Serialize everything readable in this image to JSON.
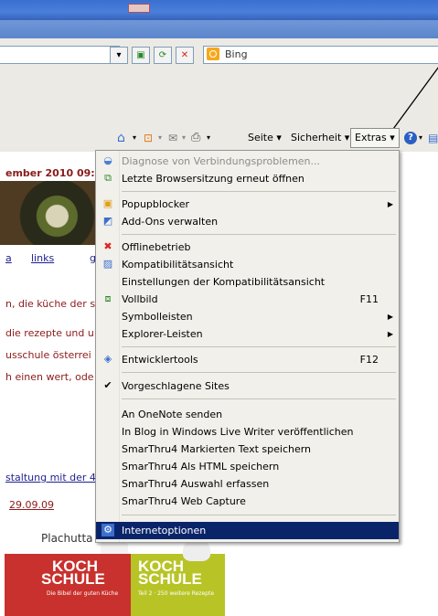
{
  "toolbar": {
    "search_engine": "Bing",
    "page_label": "Seite",
    "security_label": "Sicherheit",
    "extras_label": "Extras",
    "dropdown_arrow": "▾",
    "help_icon": "?"
  },
  "menu": {
    "items": [
      {
        "label": "Diagnose von Verbindungsproblemen...",
        "icon": "network-diagnose-icon",
        "disabled": true
      },
      {
        "label": "Letzte Browsersitzung erneut öffnen",
        "icon": "reopen-session-icon"
      },
      {
        "label": "Popupblocker",
        "icon": "popup-blocker-icon",
        "submenu": true
      },
      {
        "label": "Add-Ons verwalten",
        "icon": "addons-icon"
      },
      {
        "label": "Offlinebetrieb",
        "icon": "offline-icon"
      },
      {
        "label": "Kompatibilitätsansicht",
        "icon": "compatibility-icon"
      },
      {
        "label": "Einstellungen der Kompatibilitätsansicht"
      },
      {
        "label": "Vollbild",
        "icon": "fullscreen-icon",
        "shortcut": "F11"
      },
      {
        "label": "Symbolleisten",
        "submenu": true
      },
      {
        "label": "Explorer-Leisten",
        "submenu": true
      },
      {
        "label": "Entwicklertools",
        "icon": "developer-tools-icon",
        "shortcut": "F12"
      },
      {
        "label": "Vorgeschlagene Sites",
        "checked": true
      },
      {
        "label": "An OneNote senden"
      },
      {
        "label": "In Blog in Windows Live Writer veröffentlichen"
      },
      {
        "label": "SmarThru4 Markierten Text speichern"
      },
      {
        "label": "SmarThru4 Als HTML speichern"
      },
      {
        "label": "SmarThru4 Auswahl erfassen"
      },
      {
        "label": "SmarThru4 Web Capture"
      },
      {
        "label": "Internetoptionen",
        "icon": "internet-options-icon",
        "highlighted": true
      }
    ],
    "checkmark": "✔",
    "submenu_arrow": "▶"
  },
  "page": {
    "post_date": "ember 2010 09:5",
    "links": [
      "a",
      "links",
      "g"
    ],
    "lines": [
      "n, die küche der s",
      "die rezepte und u",
      "usschule österrei",
      "h einen wert, ode"
    ],
    "bottom_link": "staltung mit der 4",
    "bottom_date": "29.09.09",
    "book_brand": "Plachutta",
    "book_left_title_1": "KOCH",
    "book_left_title_2": "SCHULE",
    "book_left_sub": "Die Bibel der guten Küche",
    "book_right_title_1": "KOCH",
    "book_right_title_2": "SCHULE",
    "book_right_sub": "Teil 2 · 250 weitere Rezepte",
    "colors": {
      "link": "#1f1f8f",
      "text": "#8b1a1a",
      "menu_highlight": "#0a246a"
    }
  }
}
